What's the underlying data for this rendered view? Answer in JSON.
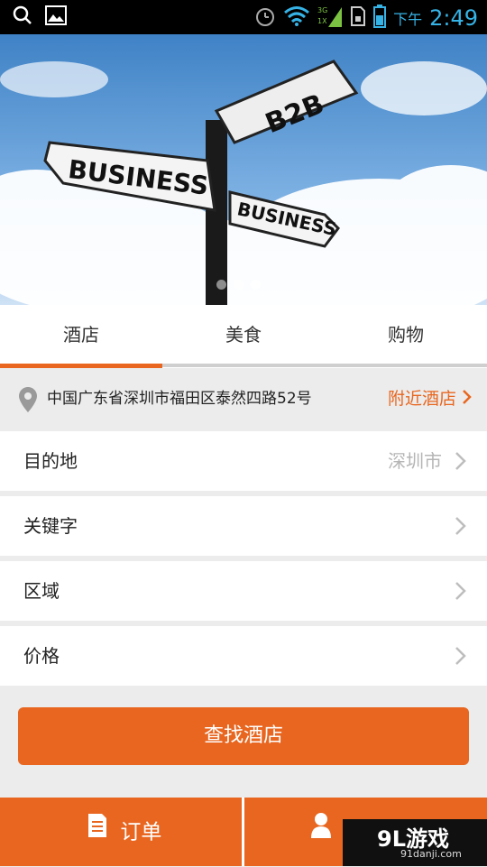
{
  "status_bar": {
    "ampm": "下午",
    "time": "2:49",
    "signal_labels": [
      "3G",
      "1X"
    ]
  },
  "banner": {
    "sign_texts": [
      "B2B",
      "BUSINESS",
      "BUSINESS"
    ],
    "dot_count": 3,
    "active_dot": 3
  },
  "tabs": [
    {
      "label": "酒店",
      "active": true
    },
    {
      "label": "美食",
      "active": false
    },
    {
      "label": "购物",
      "active": false
    }
  ],
  "location": {
    "address": "中国广东省深圳市福田区泰然四路52号",
    "nearby_label": "附近酒店"
  },
  "form": {
    "destination": {
      "label": "目的地",
      "value": "深圳市"
    },
    "keyword": {
      "label": "关键字"
    },
    "district": {
      "label": "区域"
    },
    "price": {
      "label": "价格"
    }
  },
  "search_button": "查找酒店",
  "bottom_bar": {
    "orders": "订单",
    "personal_partial": "个"
  },
  "watermark": {
    "logo": "9L游戏",
    "site": "91danji.com"
  },
  "colors": {
    "accent": "#e8661f",
    "status_blue": "#36b3e6"
  }
}
